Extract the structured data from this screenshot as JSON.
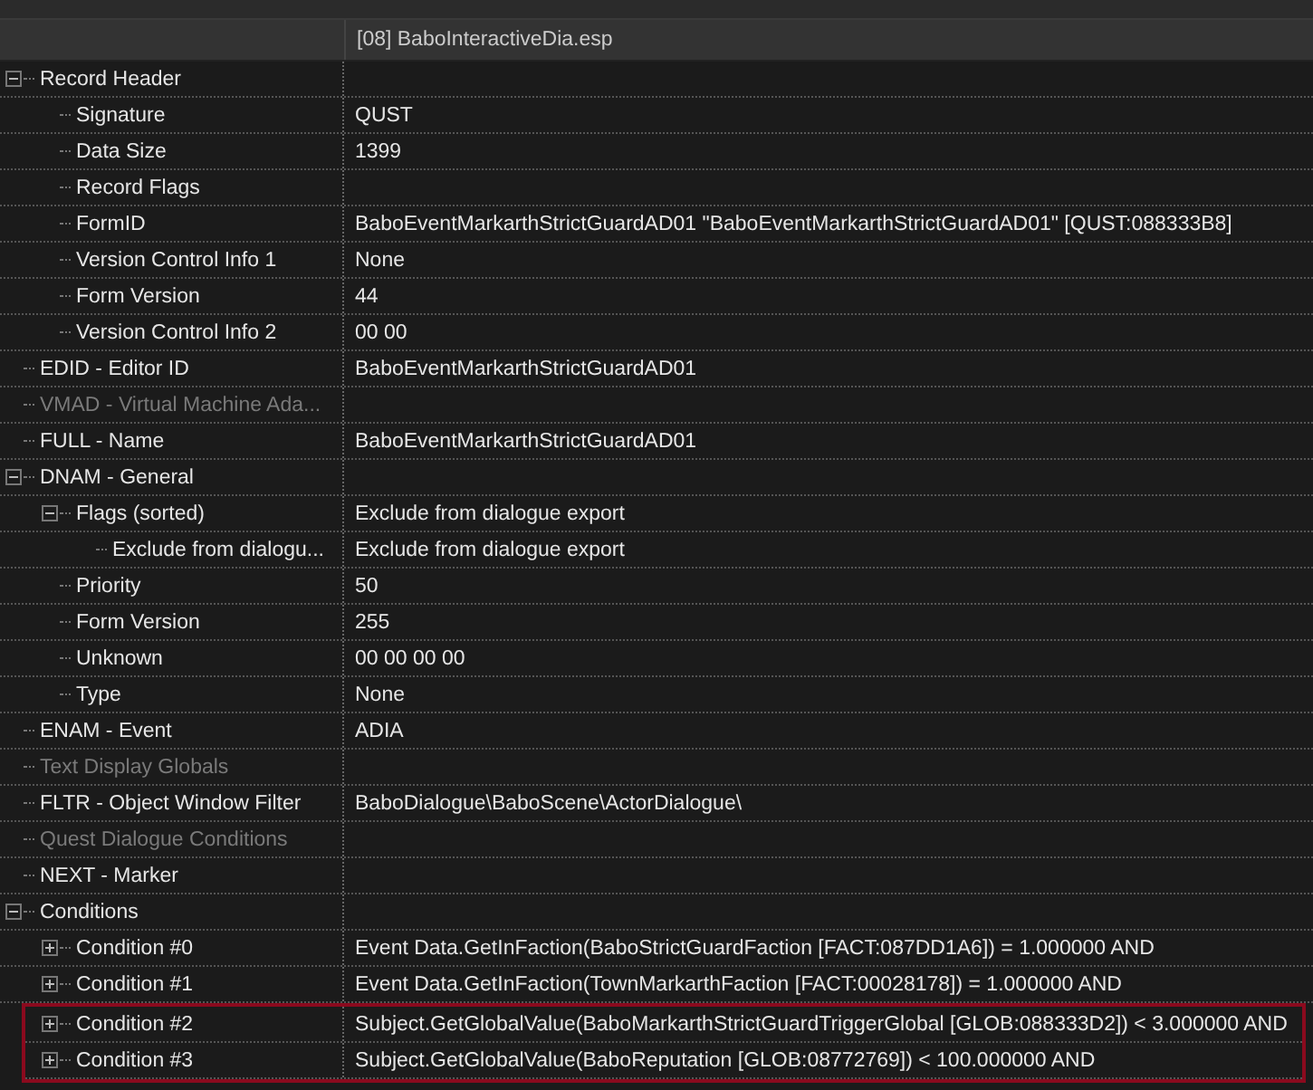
{
  "header": {
    "column_2": "[08] BaboInteractiveDia.esp"
  },
  "tree": [
    {
      "label": "Record Header",
      "expanded": true,
      "children": [
        {
          "label": "Signature",
          "value": "QUST"
        },
        {
          "label": "Data Size",
          "value": "1399"
        },
        {
          "label": "Record Flags"
        },
        {
          "label": "FormID",
          "value": "BaboEventMarkarthStrictGuardAD01 \"BaboEventMarkarthStrictGuardAD01\" [QUST:088333B8]"
        },
        {
          "label": "Version Control Info 1",
          "value": "None"
        },
        {
          "label": "Form Version",
          "value": "44"
        },
        {
          "label": "Version Control Info 2",
          "value": "00 00"
        }
      ]
    },
    {
      "label": "EDID - Editor ID",
      "value": "BaboEventMarkarthStrictGuardAD01"
    },
    {
      "label": "VMAD - Virtual Machine Ada...",
      "disabled": true
    },
    {
      "label": "FULL - Name",
      "value": "BaboEventMarkarthStrictGuardAD01"
    },
    {
      "label": "DNAM - General",
      "expanded": true,
      "children": [
        {
          "label": "Flags (sorted)",
          "value": "Exclude from dialogue export",
          "expanded": true,
          "children": [
            {
              "label": "Exclude from dialogu...",
              "value": "Exclude from dialogue export"
            }
          ]
        },
        {
          "label": "Priority",
          "value": "50"
        },
        {
          "label": "Form Version",
          "value": "255"
        },
        {
          "label": "Unknown",
          "value": "00 00 00 00"
        },
        {
          "label": "Type",
          "value": "None"
        }
      ]
    },
    {
      "label": "ENAM - Event",
      "value": "ADIA"
    },
    {
      "label": "Text Display Globals",
      "disabled": true
    },
    {
      "label": "FLTR - Object Window Filter",
      "value": "BaboDialogue\\BaboScene\\ActorDialogue\\"
    },
    {
      "label": "Quest Dialogue Conditions",
      "disabled": true
    },
    {
      "label": "NEXT - Marker"
    },
    {
      "label": "Conditions",
      "expanded": true,
      "children": [
        {
          "label": "Condition #0",
          "value": "Event Data.GetInFaction(BaboStrictGuardFaction [FACT:087DD1A6]) = 1.000000 AND",
          "expanded": false,
          "highlighted": false
        },
        {
          "label": "Condition #1",
          "value": "Event Data.GetInFaction(TownMarkarthFaction [FACT:00028178]) = 1.000000 AND",
          "expanded": false,
          "highlighted": false
        },
        {
          "label": "Condition #2",
          "value": "Subject.GetGlobalValue(BaboMarkarthStrictGuardTriggerGlobal [GLOB:088333D2]) < 3.000000 AND",
          "expanded": false,
          "highlighted": true
        },
        {
          "label": "Condition #3",
          "value": "Subject.GetGlobalValue(BaboReputation [GLOB:08772769]) < 100.000000 AND",
          "expanded": false,
          "highlighted": true
        }
      ]
    }
  ]
}
